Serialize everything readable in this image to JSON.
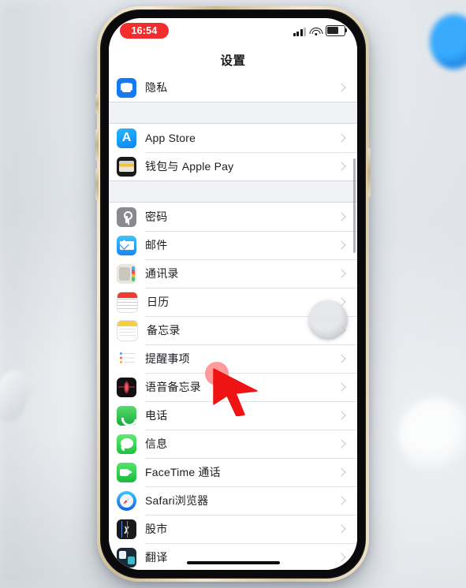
{
  "background": {
    "desk_color": "#dfe3e7",
    "objects": [
      {
        "name": "blue-round-object",
        "color": "#1f9bff"
      },
      {
        "name": "stylus-pen",
        "color": "#ffffff"
      },
      {
        "name": "mouse",
        "color": "#f2f5f8"
      }
    ]
  },
  "device": {
    "model_frame_color": "#e6d6b4",
    "bezel_color": "#0a0a0c",
    "screen_bg": "#ffffff"
  },
  "status_bar": {
    "recording_time": "16:54",
    "recording_badge_color": "#f32c2c",
    "signal_icon": "cellular-bars-icon",
    "signal_bars_active": 3,
    "signal_bars_total": 4,
    "wifi_icon": "wifi-icon",
    "battery_icon": "battery-icon",
    "battery_level_pct": 60
  },
  "nav": {
    "title": "设置"
  },
  "list": [
    {
      "type": "group",
      "rows": [
        {
          "label": "隐私",
          "icon": "privacy-hand-icon",
          "icon_class": "ic-privacy",
          "chevron": true
        }
      ]
    },
    {
      "type": "group",
      "rows": [
        {
          "label": "App Store",
          "icon": "app-store-icon",
          "icon_class": "ic-appstore",
          "chevron": true
        },
        {
          "label": "钱包与 Apple Pay",
          "icon": "wallet-icon",
          "icon_class": "ic-wallet",
          "chevron": true
        }
      ]
    },
    {
      "type": "group",
      "rows": [
        {
          "label": "密码",
          "icon": "passwords-key-icon",
          "icon_class": "ic-pass",
          "chevron": true
        },
        {
          "label": "邮件",
          "icon": "mail-icon",
          "icon_class": "ic-mail",
          "chevron": true
        },
        {
          "label": "通讯录",
          "icon": "contacts-icon",
          "icon_class": "ic-contacts",
          "chevron": true
        },
        {
          "label": "日历",
          "icon": "calendar-icon",
          "icon_class": "ic-cal",
          "chevron": true
        },
        {
          "label": "备忘录",
          "icon": "notes-icon",
          "icon_class": "ic-notes",
          "chevron": true
        },
        {
          "label": "提醒事项",
          "icon": "reminders-icon",
          "icon_class": "ic-remind",
          "chevron": true
        },
        {
          "label": "语音备忘录",
          "icon": "voice-memos-icon",
          "icon_class": "ic-voice",
          "chevron": true
        },
        {
          "label": "电话",
          "icon": "phone-icon",
          "icon_class": "ic-phone",
          "chevron": true
        },
        {
          "label": "信息",
          "icon": "messages-icon",
          "icon_class": "ic-msg",
          "chevron": true
        },
        {
          "label": "FaceTime 通话",
          "icon": "facetime-icon",
          "icon_class": "ic-ft",
          "chevron": true
        },
        {
          "label": "Safari浏览器",
          "icon": "safari-icon",
          "icon_class": "ic-safari",
          "chevron": true
        },
        {
          "label": "股市",
          "icon": "stocks-icon",
          "icon_class": "ic-stocks",
          "chevron": true
        },
        {
          "label": "翻译",
          "icon": "translate-icon",
          "icon_class": "ic-trans",
          "chevron": true
        }
      ]
    }
  ],
  "overlays": {
    "touch_indicator": "screen-recording-touch-circle",
    "cursor": "red-arrow-cursor",
    "tap_highlight_color": "#f76e6e",
    "cursor_color": "#ee1414",
    "target_row_label": "电话"
  },
  "home_indicator": "home-indicator-bar"
}
